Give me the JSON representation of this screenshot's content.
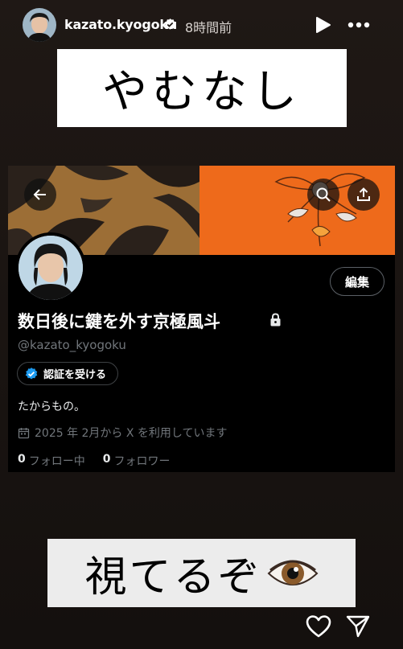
{
  "story": {
    "username": "kazato.kyogoku",
    "time_ago": "8時間前",
    "caption_top": "やむなし",
    "caption_bottom": "視てるぞ",
    "icons": [
      "play-icon",
      "more-icon",
      "verified-icon",
      "heart-icon",
      "send-icon",
      "eye-icon"
    ]
  },
  "profile": {
    "display_name": "数日後に鍵を外す京極風斗",
    "handle": "@kazato_kyogoku",
    "edit_label": "編集",
    "verify_label": "認証を受ける",
    "bio": "たからもの。",
    "joined": "2025 年 2月から X を利用しています",
    "following_count": "0",
    "following_label": "フォロー中",
    "followers_count": "0",
    "followers_label": "フォロワー",
    "icons": [
      "back-arrow-icon",
      "search-icon",
      "share-icon",
      "lock-icon",
      "calendar-icon"
    ]
  },
  "colors": {
    "banner_orange": "#ee6a1b",
    "verified_blue": "#1d9bf0",
    "muted_text": "#71767b"
  }
}
